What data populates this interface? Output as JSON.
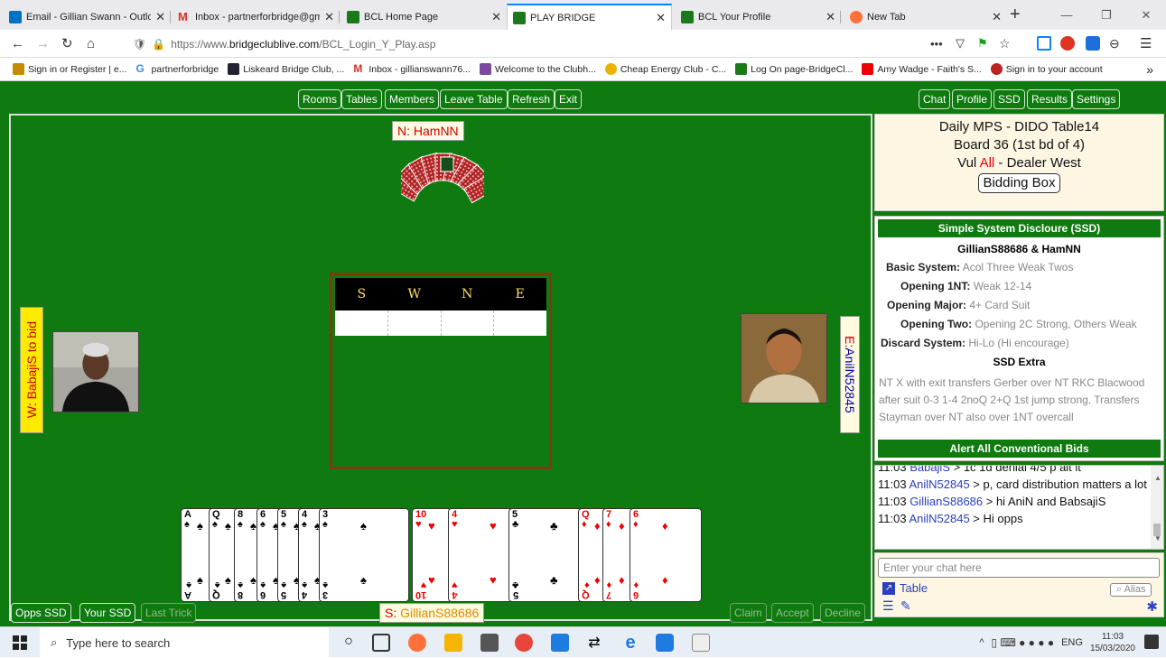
{
  "browser": {
    "tabs": [
      {
        "title": "Email - Gillian Swann - Outlo",
        "color": "#0072c6"
      },
      {
        "title": "Inbox - partnerforbridge@gm",
        "color": "#d93025"
      },
      {
        "title": "BCL Home Page",
        "color": "#1a7a1a"
      },
      {
        "title": "PLAY BRIDGE",
        "color": "#1a7a1a"
      },
      {
        "title": "BCL Your Profile",
        "color": "#1a7a1a"
      },
      {
        "title": "New Tab",
        "color": "#ff7139"
      }
    ],
    "url_prefix": "https://www.",
    "url_domain": "bridgeclublive.com",
    "url_path": "/BCL_Login_Y_Play.asp",
    "bookmarks": [
      "Sign in or Register | e...",
      "partnerforbridge",
      "Liskeard Bridge Club, ...",
      "Inbox - gillianswann76...",
      "Welcome to the Clubh...",
      "Cheap Energy Club - C...",
      "Log On page-BridgeCl...",
      "Amy Wadge - Faith's S...",
      "Sign in to your account"
    ]
  },
  "toolbar": {
    "rooms": "Rooms",
    "tables": "Tables",
    "members": "Members",
    "leave": "Leave Table",
    "refresh": "Refresh",
    "exit": "Exit",
    "chat": "Chat",
    "profile": "Profile",
    "ssd": "SSD",
    "results": "Results",
    "settings": "Settings"
  },
  "seats": {
    "north_dir": "N:",
    "north_name": "HamNN",
    "south_dir": "S:",
    "south_name": "GillianS88686",
    "west": "W: BabajiS to bid",
    "east_dir": "E:",
    "east_name": "AnilN52845"
  },
  "bidding": {
    "headers": [
      "S",
      "W",
      "N",
      "E"
    ]
  },
  "bottom_buttons": {
    "opps_ssd": "Opps SSD",
    "your_ssd": "Your SSD",
    "last_trick": "Last Trick",
    "claim": "Claim",
    "accept": "Accept",
    "decline": "Decline"
  },
  "hand": [
    {
      "rank": "A",
      "suit": "♠",
      "color": "black"
    },
    {
      "rank": "Q",
      "suit": "♠",
      "color": "black"
    },
    {
      "rank": "8",
      "suit": "♠",
      "color": "black"
    },
    {
      "rank": "6",
      "suit": "♠",
      "color": "black"
    },
    {
      "rank": "5",
      "suit": "♠",
      "color": "black"
    },
    {
      "rank": "4",
      "suit": "♠",
      "color": "black"
    },
    {
      "rank": "3",
      "suit": "♠",
      "color": "black"
    },
    {
      "rank": "10",
      "suit": "♥",
      "color": "red"
    },
    {
      "rank": "4",
      "suit": "♥",
      "color": "red"
    },
    {
      "rank": "5",
      "suit": "♣",
      "color": "black"
    },
    {
      "rank": "Q",
      "suit": "♦",
      "color": "red"
    },
    {
      "rank": "7",
      "suit": "♦",
      "color": "red"
    },
    {
      "rank": "6",
      "suit": "♦",
      "color": "red"
    }
  ],
  "info": {
    "line1": "Daily MPS - DIDO Table14",
    "line2": "Board 36 (1st bd of 4)",
    "vul_prefix": "Vul ",
    "vul_value": "All",
    "vul_suffix": " - Dealer West",
    "bidding_box": "Bidding Box"
  },
  "ssd": {
    "title": "Simple System Discloure (SSD)",
    "pair": "GillianS88686 & HamNN",
    "rows": [
      {
        "label": "Basic System:",
        "value": "Acol Three Weak Twos"
      },
      {
        "label": "Opening 1NT:",
        "value": "Weak 12-14"
      },
      {
        "label": "Opening Major:",
        "value": "4+ Card Suit"
      },
      {
        "label": "Opening Two:",
        "value": "Opening 2C Strong, Others Weak"
      },
      {
        "label": "Discard System:",
        "value": "Hi-Lo (Hi encourage)"
      }
    ],
    "extra_title": "SSD Extra",
    "extra_text": "NT X with exit transfers Gerber over NT RKC Blacwood after suit 0-3 1-4 2noQ 2+Q 1st jump strong. Transfers Stayman over NT also over 1NT overcall",
    "alert": "Alert All Conventional Bids"
  },
  "chat": {
    "lines": [
      {
        "time": "11:03 ",
        "user": "BabajiS",
        "text": " > 1c 1d denial 4/5 p alt it"
      },
      {
        "time": "11:03 ",
        "user": "AnilN52845",
        "text": " > p, card distribution matters a lot"
      },
      {
        "time": "11:03 ",
        "user": "GillianS88686",
        "text": " > hi AniN and BabsajiS"
      },
      {
        "time": "11:03 ",
        "user": "AnilN52845",
        "text": " > Hi opps"
      }
    ],
    "placeholder": "Enter your chat here",
    "table_link": "Table",
    "alias": "Alias"
  },
  "taskbar": {
    "search_placeholder": "Type here to search",
    "lang": "ENG",
    "time": "11:03",
    "date": "15/03/2020"
  }
}
